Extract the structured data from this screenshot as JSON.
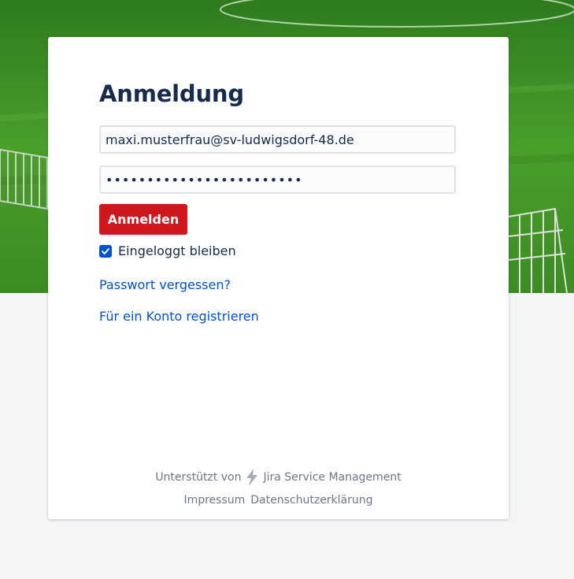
{
  "login": {
    "title": "Anmeldung",
    "email_value": "maxi.musterfrau@sv-ludwigsdorf-48.de",
    "password_value": "••••••••••••••••••••••••",
    "submit_label": "Anmelden",
    "remember_label": "Eingeloggt bleiben",
    "remember_checked": true,
    "forgot_label": "Passwort vergessen?",
    "register_label": "Für ein Konto registrieren"
  },
  "footer": {
    "powered_prefix": "Unterstützt von",
    "powered_product": "Jira Service Management",
    "powered_icon": "lightning-bolt-icon",
    "links": [
      "Impressum",
      "Datenschutzerklärung"
    ]
  },
  "colors": {
    "primary_button": "#d0171d",
    "link": "#0052cc",
    "heading": "#172b4d",
    "muted": "#6b778c",
    "checkbox": "#0052cc"
  }
}
